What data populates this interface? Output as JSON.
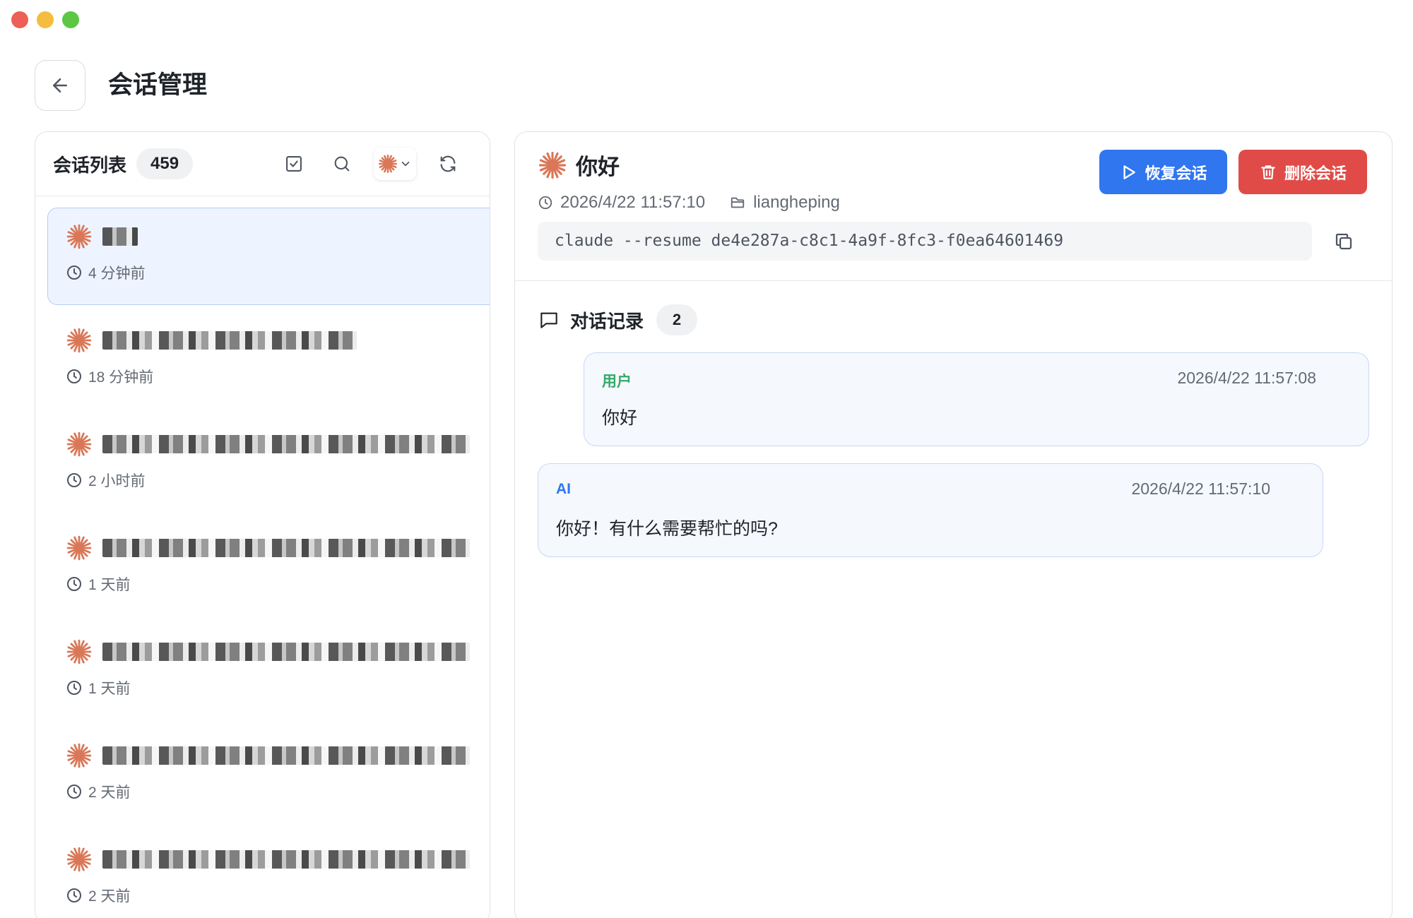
{
  "header": {
    "title": "会话管理"
  },
  "session_list": {
    "title": "会话列表",
    "count": "459",
    "items": [
      {
        "time": "4 分钟前",
        "blur_width": 50,
        "active": true
      },
      {
        "time": "18 分钟前",
        "blur_width": 360,
        "active": false
      },
      {
        "time": "2 小时前",
        "blur_width": 520,
        "active": false
      },
      {
        "time": "1 天前",
        "blur_width": 520,
        "active": false
      },
      {
        "time": "1 天前",
        "blur_width": 520,
        "active": false
      },
      {
        "time": "2 天前",
        "blur_width": 520,
        "active": false
      },
      {
        "time": "2 天前",
        "blur_width": 520,
        "active": false
      }
    ]
  },
  "detail": {
    "title": "你好",
    "datetime": "2026/4/22 11:57:10",
    "folder": "liangheping",
    "command": "claude --resume de4e287a-c8c1-4a9f-8fc3-f0ea64601469",
    "resume_label": "恢复会话",
    "delete_label": "删除会话",
    "chat_title": "对话记录",
    "chat_count": "2",
    "messages": [
      {
        "role": "用户",
        "time": "2026/4/22 11:57:08",
        "text": "你好"
      },
      {
        "role": "AI",
        "time": "2026/4/22 11:57:10",
        "text": "你好！有什么需要帮忙的吗?"
      }
    ]
  },
  "colors": {
    "accent_blue": "#2f76ef",
    "danger_red": "#e04b48",
    "claude_orange": "#d97757",
    "user_green": "#35a86a"
  }
}
